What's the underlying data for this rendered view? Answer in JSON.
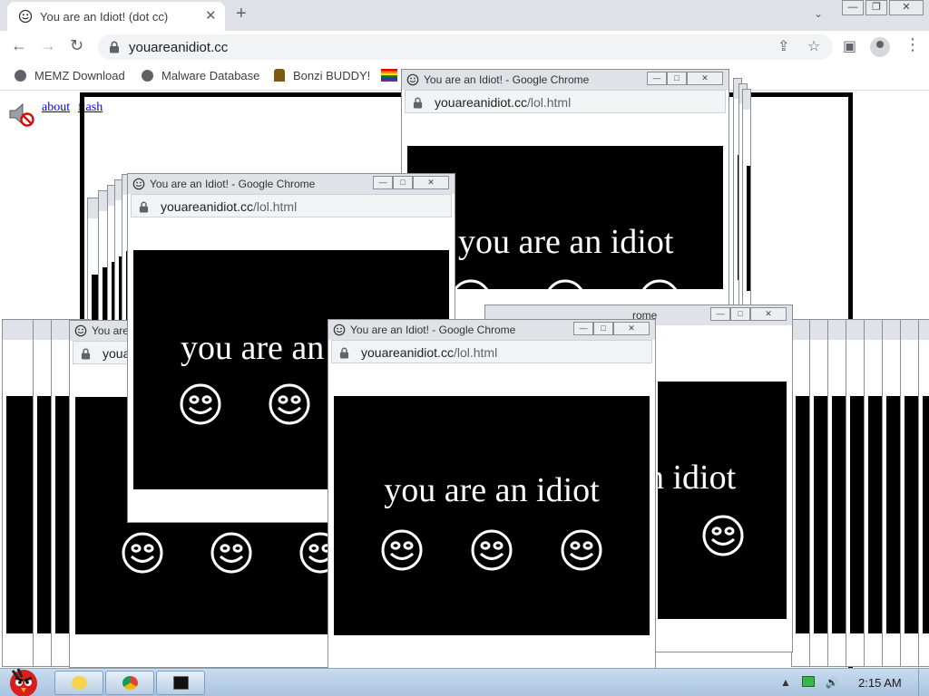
{
  "browser": {
    "tab_title": "You are an Idiot! (dot cc)",
    "tab_close": "✕",
    "new_tab": "+",
    "tab_dropdown": "⌄",
    "window_controls": {
      "minimize": "—",
      "restore": "❐",
      "close": "✕"
    },
    "nav": {
      "back": "←",
      "forward": "→",
      "reload": "↻"
    },
    "address": "youareanidiot.cc",
    "toolbar_icons": {
      "share": "⇪",
      "star": "☆",
      "sidebar": "▣",
      "menu": "⋮"
    }
  },
  "bookmarks": [
    {
      "label": "MEMZ Download"
    },
    {
      "label": "Malware Database"
    },
    {
      "label": "Bonzi BUDDY!"
    }
  ],
  "page": {
    "link_about": "about",
    "link_flash": "flash"
  },
  "popup": {
    "title": "You are an Idiot! - Google Chrome",
    "title_fragment": "rome",
    "url_host": "youareanidiot.cc",
    "url_path": "/lol.html",
    "caption": "you are an idiot",
    "caption_fragment": "n idiot",
    "buttons": {
      "minimize": "—",
      "maximize": "□",
      "close": "✕"
    }
  },
  "taskbar": {
    "time": "2:15 AM"
  },
  "colors": {
    "tab_bar": "#dee1e6",
    "omnibox": "#f1f3f4",
    "popup_titlebar": "#dfe2e7",
    "taskbar": "#b8cde3",
    "link": "#0000ee",
    "rainbow_icon": [
      "#e40303",
      "#ff8c00",
      "#ffed00",
      "#008026",
      "#24408e",
      "#732982"
    ]
  },
  "icons": {
    "tab": "smiley-icon",
    "security": "lock-icon",
    "bookmark": "globe-icon",
    "speaker": "speaker-muted-icon",
    "start": "angry-bird-icon"
  }
}
